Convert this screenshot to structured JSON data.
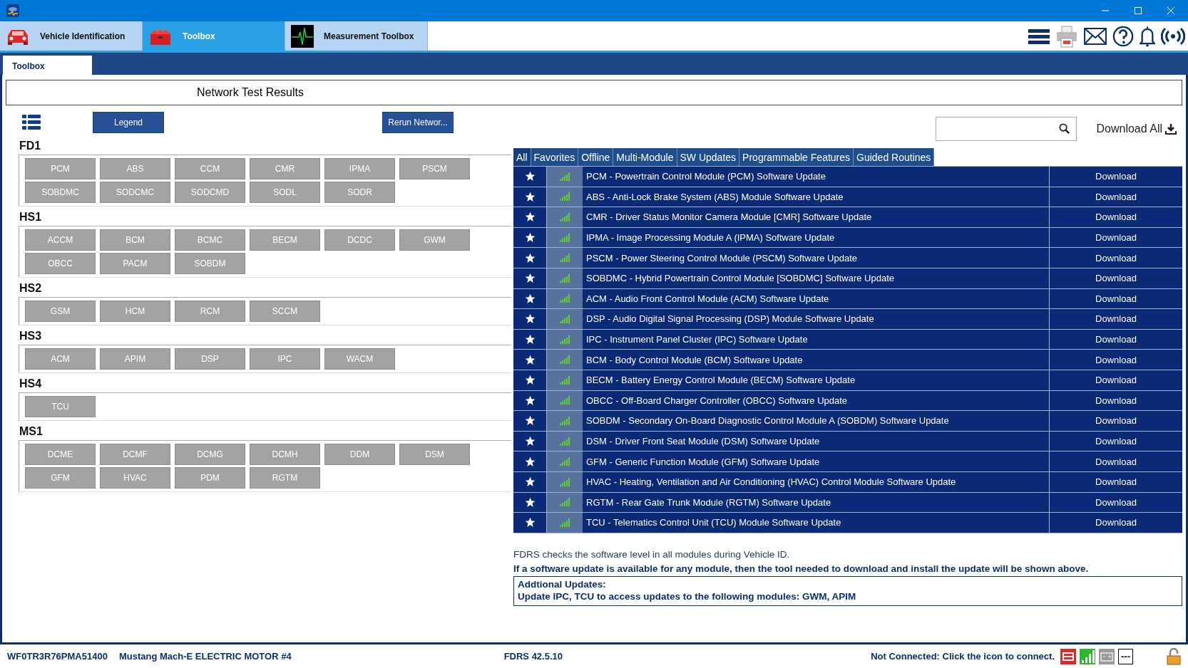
{
  "app_tabs": [
    {
      "label": "Vehicle Identification",
      "selected": false
    },
    {
      "label": "Toolbox",
      "selected": true
    },
    {
      "label": "Measurement Toolbox",
      "selected": false
    }
  ],
  "sub_tab": {
    "label": "Toolbox"
  },
  "header": {
    "title": "Network Test Results"
  },
  "network": {
    "legend_button": "Legend",
    "rerun_button": "Rerun Networ...",
    "groups": [
      {
        "name": "FD1",
        "modules": [
          "PCM",
          "ABS",
          "CCM",
          "CMR",
          "IPMA",
          "PSCM",
          "SOBDMC",
          "SODCMC",
          "SODCMD",
          "SODL",
          "SODR"
        ]
      },
      {
        "name": "HS1",
        "modules": [
          "ACCM",
          "BCM",
          "BCMC",
          "BECM",
          "DCDC",
          "GWM",
          "OBCC",
          "PACM",
          "SOBDM"
        ]
      },
      {
        "name": "HS2",
        "modules": [
          "GSM",
          "HCM",
          "RCM",
          "SCCM"
        ]
      },
      {
        "name": "HS3",
        "modules": [
          "ACM",
          "APIM",
          "DSP",
          "IPC",
          "WACM"
        ]
      },
      {
        "name": "HS4",
        "modules": [
          "TCU"
        ]
      },
      {
        "name": "MS1",
        "modules": [
          "DCME",
          "DCMF",
          "DCMG",
          "DCMH",
          "DDM",
          "DSM",
          "GFM",
          "HVAC",
          "PDM",
          "RGTM"
        ]
      }
    ]
  },
  "download_all": "Download All",
  "filter_tabs": [
    {
      "label": "All",
      "selected": true
    },
    {
      "label": "Favorites",
      "selected": false
    },
    {
      "label": "Offline",
      "selected": false
    },
    {
      "label": "Multi-Module",
      "selected": false
    },
    {
      "label": "SW Updates",
      "selected": false
    },
    {
      "label": "Programmable Features",
      "selected": false
    },
    {
      "label": "Guided Routines",
      "selected": false
    }
  ],
  "updates": [
    {
      "title": "PCM - Powertrain Control Module (PCM) Software Update",
      "action": "Download"
    },
    {
      "title": "ABS - Anti-Lock Brake System (ABS) Module Software Update",
      "action": "Download"
    },
    {
      "title": "CMR - Driver Status Monitor Camera Module [CMR] Software Update",
      "action": "Download"
    },
    {
      "title": "IPMA - Image Processing Module A (IPMA) Software Update",
      "action": "Download"
    },
    {
      "title": "PSCM - Power Steering Control Module (PSCM) Software Update",
      "action": "Download"
    },
    {
      "title": "SOBDMC - Hybrid Powertrain Control Module [SOBDMC] Software Update",
      "action": "Download"
    },
    {
      "title": "ACM - Audio Front Control Module (ACM) Software Update",
      "action": "Download"
    },
    {
      "title": "DSP - Audio Digital Signal Processing (DSP) Module Software Update",
      "action": "Download"
    },
    {
      "title": "IPC - Instrument Panel Cluster (IPC) Software Update",
      "action": "Download"
    },
    {
      "title": "BCM - Body Control Module (BCM) Software Update",
      "action": "Download"
    },
    {
      "title": "BECM - Battery Energy Control Module (BECM) Software Update",
      "action": "Download"
    },
    {
      "title": "OBCC - Off-Board Charger Controller (OBCC) Software Update",
      "action": "Download"
    },
    {
      "title": "SOBDM - Secondary On-Board Diagnostic Control Module A (SOBDM) Software Update",
      "action": "Download"
    },
    {
      "title": "DSM - Driver Front Seat Module (DSM) Software Update",
      "action": "Download"
    },
    {
      "title": "GFM - Generic Function Module (GFM) Software Update",
      "action": "Download"
    },
    {
      "title": "HVAC - Heating, Ventilation and Air Conditioning (HVAC) Control Module Software Update",
      "action": "Download"
    },
    {
      "title": "RGTM - Rear Gate Trunk Module (RGTM) Software Update",
      "action": "Download"
    },
    {
      "title": "TCU - Telematics Control Unit (TCU) Module Software Update",
      "action": "Download"
    }
  ],
  "notes": {
    "info": "FDRS checks the software level in all modules during Vehicle ID.",
    "warning": "If a software update is available for any module, then the tool needed to download and install the update will be shown above.",
    "additional_title": "Addtional Updates:",
    "additional_text": "Update IPC, TCU to access updates to the following modules: GWM, APIM"
  },
  "status_bar": {
    "vin": "WF0TR3R76PMA51400",
    "vehicle": "Mustang Mach-E ELECTRIC MOTOR #4",
    "version": "FDRS 42.5.10",
    "connection": "Not Connected: Click the icon to connect.",
    "indicator": "---"
  }
}
